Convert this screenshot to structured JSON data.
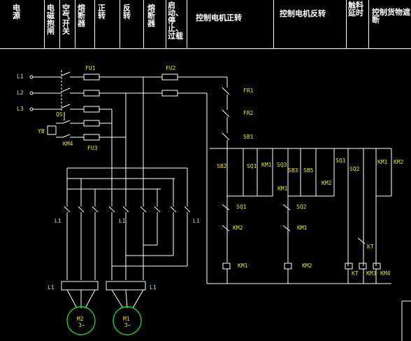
{
  "header": {
    "cells": [
      {
        "id": "power",
        "label": "电源"
      },
      {
        "id": "brake",
        "label": "电磁抱闸"
      },
      {
        "id": "breaker",
        "label": "空气开关"
      },
      {
        "id": "fuse1",
        "label": "熔断器"
      },
      {
        "id": "forward",
        "label": "正转"
      },
      {
        "id": "reverse",
        "label": "反转"
      },
      {
        "id": "fuse2",
        "label": "熔断器"
      },
      {
        "id": "startstop",
        "label": "启动、停止、过载"
      },
      {
        "id": "ctrl_fwd",
        "label": "控制电机正转"
      },
      {
        "id": "ctrl_rev",
        "label": "控制电机反转"
      },
      {
        "id": "delay",
        "label": "触料延时"
      },
      {
        "id": "cutoff",
        "label": "控制货物遮断"
      }
    ]
  },
  "labels": {
    "l1": "L1",
    "l2": "L2",
    "l3": "L3",
    "fu1": "FU1",
    "fu2": "FU2",
    "fu3": "FU3",
    "qs": "QS",
    "yb": "YB",
    "km4_left": "KM4",
    "fr1": "FR1",
    "fr2": "FR2",
    "sb1": "SB1",
    "sb2": "SB2",
    "sq1a": "SQ1",
    "km1a": "KM1",
    "sq3a": "SQ3",
    "sb3": "SB3",
    "sb5": "SB5",
    "sq1b": "SQ1",
    "sq2a": "SQ2",
    "km1b": "KM1",
    "km2b": "KM2",
    "km1c": "KM1",
    "km2c": "KM2",
    "sq1c": "SQ1",
    "sq2b": "SQ2",
    "km2d": "KM2",
    "km1d": "KM1",
    "kt1": "KT",
    "km1coil": "KM1",
    "km2coil": "KM2",
    "ktcoil": "KT",
    "km3coil": "KM3",
    "km4coil": "KM4",
    "ml1a": "L1",
    "ml1b": "L1",
    "ml1c": "L1",
    "ml1d": "L1",
    "ml1e": "L1",
    "m2": "M2",
    "m2sub": "3~",
    "m1": "M1",
    "m1sub": "3~"
  }
}
